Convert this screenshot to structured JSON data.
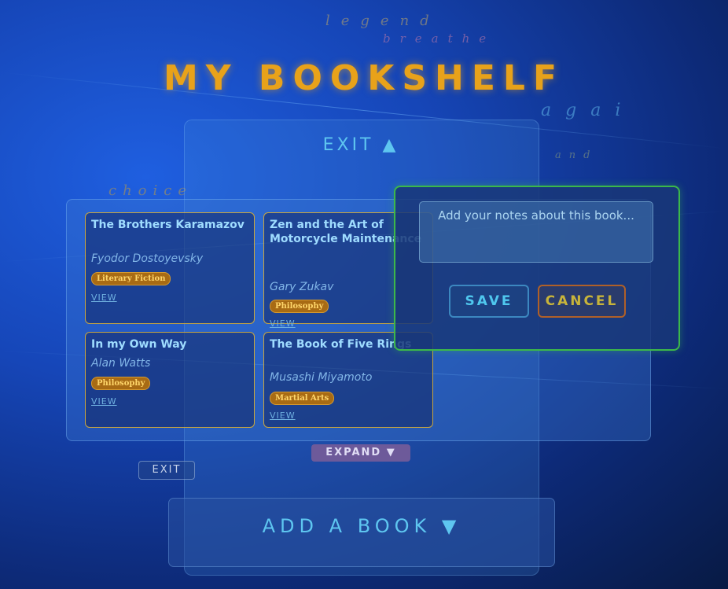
{
  "page_title": "MY BOOKSHELF",
  "exit_top": "EXIT ▲",
  "books": [
    {
      "title": "The Brothers Karamazov",
      "author": "Fyodor Dostoyevsky",
      "genre": "Literary Fiction",
      "view": "VIEW"
    },
    {
      "title": "Zen and the Art of Motorcycle Maintenance",
      "author": "Gary Zukav",
      "genre": "Philosophy",
      "view": "VIEW"
    },
    {
      "title": "In my Own Way",
      "author": "Alan Watts",
      "genre": "Philosophy",
      "view": "VIEW"
    },
    {
      "title": "The Book of Five Rings",
      "author": "Musashi Miyamoto",
      "genre": "Martial Arts",
      "view": "VIEW"
    }
  ],
  "notes": {
    "placeholder": "Add your notes about this book...",
    "save_label": "SAVE",
    "cancel_label": "CANCEL"
  },
  "expand_label": "EXPAND ▼",
  "exit_small": "EXIT",
  "add_book_label": "ADD A BOOK ▼",
  "background_words": [
    "legend",
    "breathe",
    "choice",
    "agai",
    "and"
  ],
  "colors": {
    "title": "#e8a21a",
    "accent": "#5ec6f0",
    "dialog_border": "#3cb84a",
    "badge": "#a86b14"
  }
}
